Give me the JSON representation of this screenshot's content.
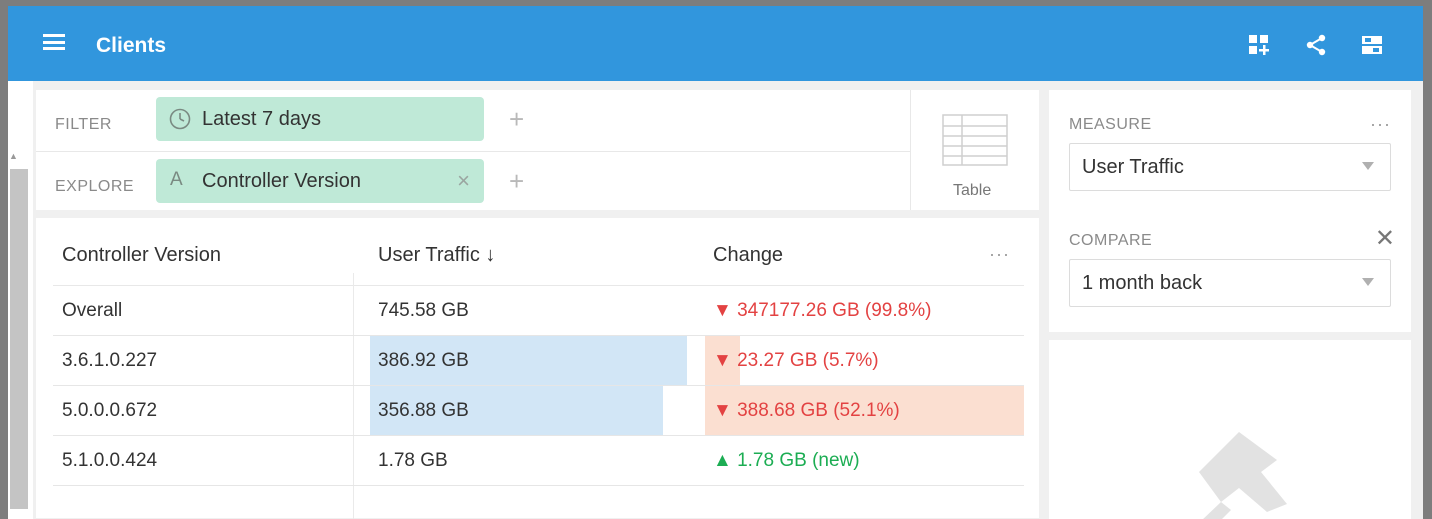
{
  "app": {
    "title": "Clients"
  },
  "filter": {
    "filter_label": "FILTER",
    "filter_pill": "Latest 7 days",
    "explore_label": "EXPLORE",
    "explore_pill": "Controller Version",
    "add_symbol": "+",
    "remove_symbol": "×"
  },
  "visualization": {
    "label": "Table",
    "icon": "table-icon"
  },
  "table": {
    "headers": [
      "Controller Version",
      "User Traffic ↓",
      "Change"
    ],
    "more": "···",
    "rows": [
      {
        "version": "Overall",
        "traffic": "745.58 GB",
        "change": "▼ 347177.26 GB (99.8%)",
        "change_dir": "down"
      },
      {
        "version": "3.6.1.0.227",
        "traffic": "386.92 GB",
        "change": "▼ 23.27 GB (5.7%)",
        "change_dir": "down",
        "traffic_fraction": 0.995,
        "change_fraction": 0.11
      },
      {
        "version": "5.0.0.0.672",
        "traffic": "356.88 GB",
        "change": "▼ 388.68 GB (52.1%)",
        "change_dir": "down",
        "traffic_fraction": 0.92,
        "change_fraction": 1.0
      },
      {
        "version": "5.1.0.0.424",
        "traffic": "1.78 GB",
        "change": "▲ 1.78 GB (new)",
        "change_dir": "up"
      }
    ]
  },
  "side": {
    "measure_label": "MEASURE",
    "measure_value": "User Traffic",
    "compare_label": "COMPARE",
    "compare_value": "1 month back",
    "more": "···",
    "close": "✕"
  },
  "colors": {
    "header_bg": "#3196dd",
    "pill_bg": "#bfe9d7",
    "traffic_bar": "#d2e6f6",
    "change_bar": "#fbdfd1",
    "negative": "#e34242",
    "positive": "#1cad53"
  },
  "icons": [
    "menu-icon",
    "add-dashboard-icon",
    "share-icon",
    "layout-icon",
    "clock-icon",
    "dimension-a-icon",
    "pin-icon"
  ]
}
